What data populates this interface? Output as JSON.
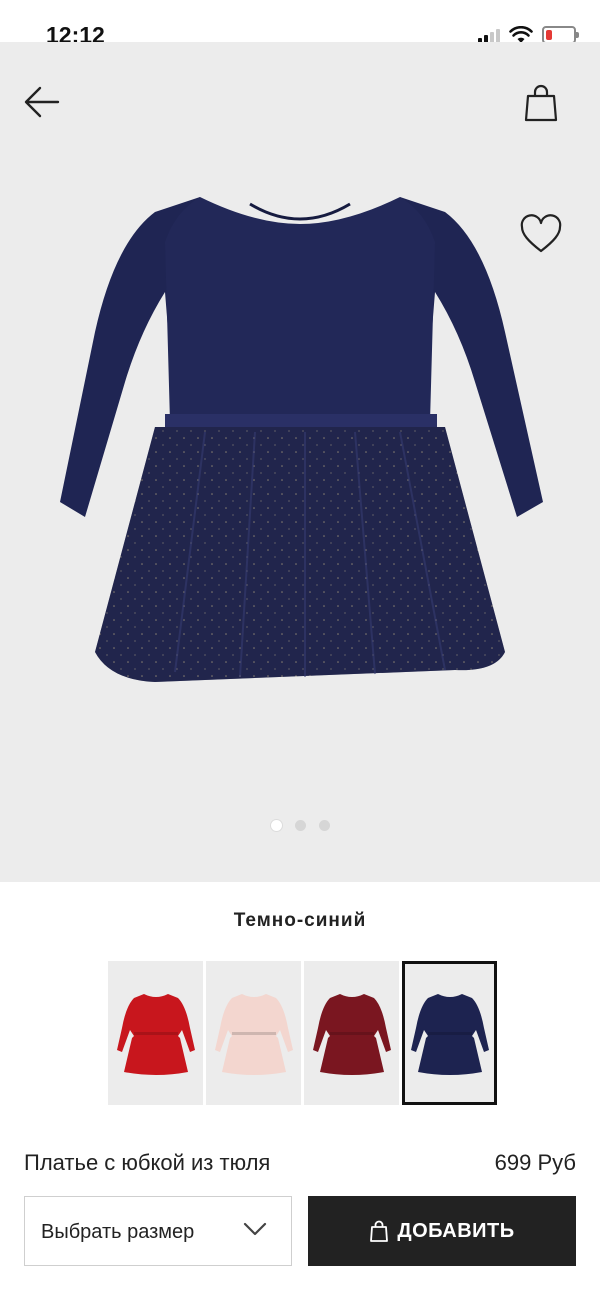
{
  "status_bar": {
    "time": "12:12",
    "battery_color": "#e53935"
  },
  "hero": {
    "back_icon": "arrow-left-icon",
    "bag_icon": "shopping-bag-icon",
    "favorite_icon": "heart-icon",
    "image_index": 1,
    "image_count": 3
  },
  "product": {
    "color_name": "Темно-синий",
    "title": "Платье с юбкой из тюля",
    "price": "699 Руб",
    "swatches": [
      {
        "color": "#c8161d",
        "selected": false
      },
      {
        "color": "#f3d6cf",
        "selected": false
      },
      {
        "color": "#7a1620",
        "selected": false
      },
      {
        "color": "#1d2350",
        "selected": true
      }
    ]
  },
  "actions": {
    "size_label": "Выбрать размер",
    "add_label": "ДОБАВИТЬ",
    "add_color": "#222222"
  }
}
